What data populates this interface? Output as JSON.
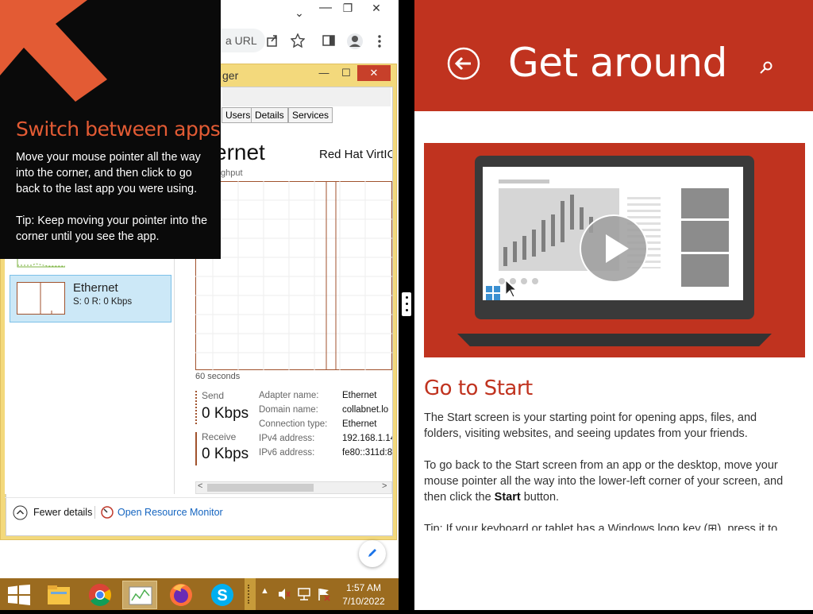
{
  "browser": {
    "address_text": "a URL",
    "chevron": "⌄",
    "restore": "❐",
    "close": "✕"
  },
  "task_manager": {
    "title": "ger",
    "minimize": "—",
    "maximize": "☐",
    "close": "✕",
    "tabs": [
      "Users",
      "Details",
      "Services"
    ],
    "heading": "ernet",
    "adapter_label": "Red Hat VirtIO",
    "throughput_label": "ghput",
    "graph_time": "60 seconds",
    "send_label": "Send",
    "send_value": "0 Kbps",
    "receive_label": "Receive",
    "receive_value": "0 Kbps",
    "details": [
      {
        "label": "Adapter name:",
        "value": "Ethernet"
      },
      {
        "label": "Domain name:",
        "value": "collabnet.lo"
      },
      {
        "label": "Connection type:",
        "value": "Ethernet"
      },
      {
        "label": "IPv4 address:",
        "value": "192.168.1.14"
      },
      {
        "label": "IPv6 address:",
        "value": "fe80::311d:8"
      }
    ],
    "sidebar_item": {
      "name": "Ethernet",
      "stats": "S: 0 R: 0 Kbps"
    },
    "fewer_details": "Fewer details",
    "open_resource_monitor": "Open Resource Monitor"
  },
  "overlay": {
    "title": "Switch between apps",
    "body": "Move your mouse pointer all the way into the corner, and then click to go back to the last app you were using.",
    "tip": "Tip: Keep moving your pointer into the corner until you see the app."
  },
  "help": {
    "title": "Get around",
    "section_title": "Go to Start",
    "p1": "The Start screen is your starting point for opening apps, files, and folders, visiting websites, and seeing updates from your friends.",
    "p2_before": "To go back to the Start screen from an app or the desktop, move your mouse pointer all the way into the lower-left corner of your screen, and then click the ",
    "p2_bold": "Start",
    "p2_after": " button.",
    "p3": "Tip: If your keyboard or tablet has a Windows logo key (⊞), press it to"
  },
  "taskbar": {
    "time": "1:57 AM",
    "date": "7/10/2022"
  },
  "colors": {
    "accent_red": "#c0331f",
    "overlay_orange": "#e35b34",
    "taskbar": "#9b6b1f"
  }
}
